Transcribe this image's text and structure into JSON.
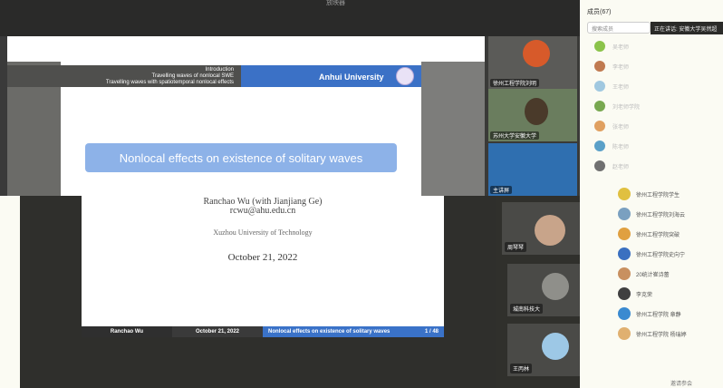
{
  "window": {
    "title": "放映器"
  },
  "slide_top": {
    "nav_lines": [
      "Introduction",
      "Travelling waves of nonlocal SWE",
      "Travelling waves with spatiotemporal nonlocal effects"
    ],
    "university": "Anhui University",
    "title": "Nonlocal effects on existence of solitary waves"
  },
  "slide_bottom": {
    "author": "Ranchao Wu (with Jianjiang Ge)",
    "email": "rcwu@ahu.edu.cn",
    "affiliation": "Xuzhou University of Technology",
    "date": "October 21, 2022",
    "footer": {
      "author": "Ranchao Wu",
      "date": "October 21, 2022",
      "title": "Nonlocal effects on existence of solitary waves",
      "page": "1 / 48"
    }
  },
  "video_tiles_top": [
    {
      "label": "徐州工程学院刘明",
      "color": "#d75a2a"
    },
    {
      "label": "苏州大学安徽大学",
      "color": "#6a7d5e"
    },
    {
      "label": "主讲屏",
      "color": "#2f6fb0"
    }
  ],
  "video_tiles_bottom": [
    {
      "label": "周琴琴",
      "color": "#c8a48a"
    },
    {
      "label": "城南科技大",
      "color": "#8f8f8a"
    },
    {
      "label": "王丙林",
      "color": "#9dc8e6"
    }
  ],
  "members": {
    "header": "成员(67)",
    "search_placeholder": "搜索成员",
    "active_speaker": "正在讲话: 安徽大学吴然超",
    "faded": [
      {
        "name": "吴老师",
        "color": "#8bc34a"
      },
      {
        "name": "李老师",
        "color": "#c07a50"
      },
      {
        "name": "王老师",
        "color": "#a0c8e0"
      },
      {
        "name": "刘老师学院",
        "color": "#78a850"
      },
      {
        "name": "张老师",
        "color": "#e0a060"
      },
      {
        "name": "陈老师",
        "color": "#5aa0c8"
      },
      {
        "name": "赵老师",
        "color": "#707070"
      }
    ],
    "visible": [
      {
        "name": "徐州工程学院学生",
        "color": "#e0c040"
      },
      {
        "name": "徐州工程学院刘海云",
        "color": "#7aa0c0"
      },
      {
        "name": "徐州工程学院突破",
        "color": "#e0a040"
      },
      {
        "name": "徐州工程学院史向宁",
        "color": "#3a70c0"
      },
      {
        "name": "20统计崔诗蕾",
        "color": "#c89060"
      },
      {
        "name": "李克荣",
        "color": "#404040"
      },
      {
        "name": "徐州工程学院 章静",
        "color": "#3a8ad0"
      },
      {
        "name": "徐州工程学院 杨瑞婷",
        "color": "#e0b070"
      }
    ],
    "footer": "邀请参会"
  }
}
